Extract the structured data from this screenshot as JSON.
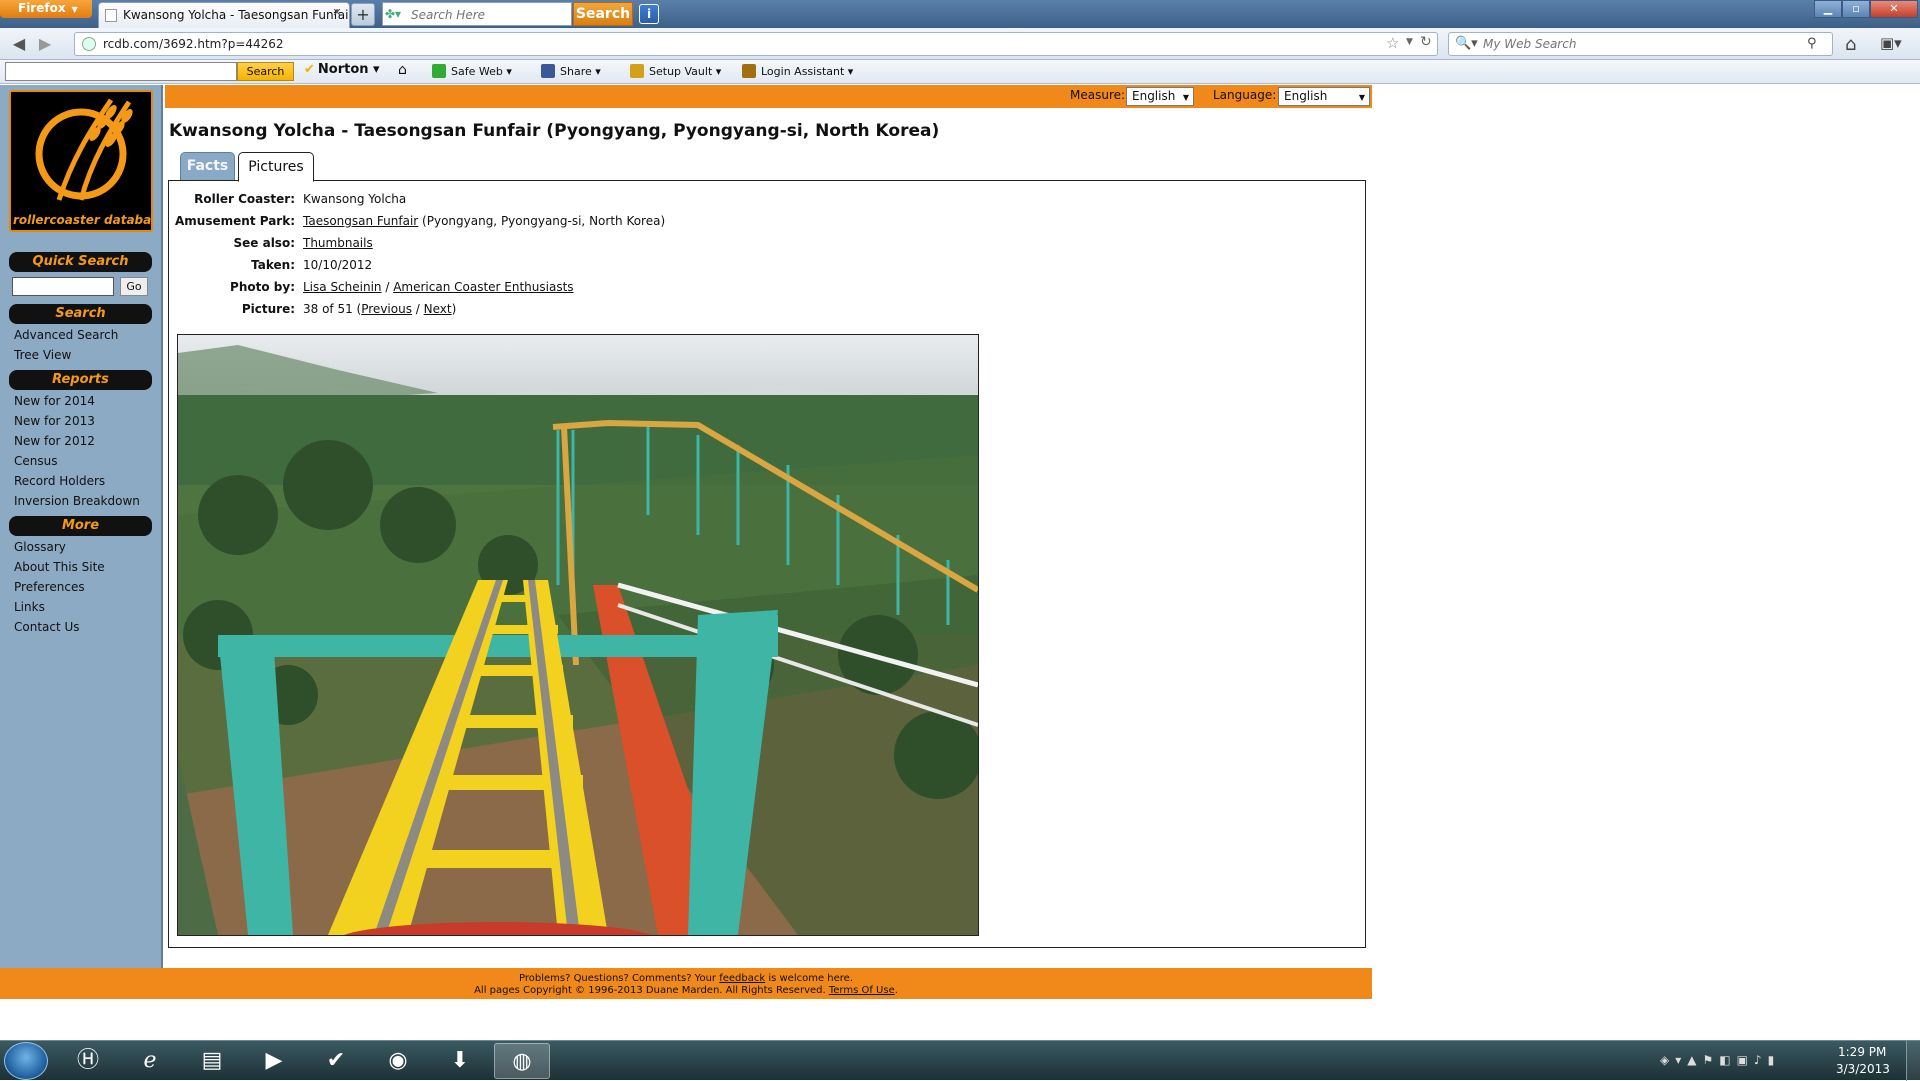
{
  "browser": {
    "firefox_button": "Firefox",
    "tab_title": "Kwansong Yolcha - Taesongsan Funfair ...",
    "new_tab": "+",
    "top_search_placeholder": "Search Here",
    "top_search_button": "Search",
    "url": "rcdb.com/3692.htm?p=44262",
    "web_search_placeholder": "My Web Search"
  },
  "toolbar": {
    "search_button": "Search",
    "norton": "Norton",
    "safe_web": "Safe Web",
    "share": "Share",
    "setup_vault": "Setup Vault",
    "login_assistant": "Login Assistant"
  },
  "header": {
    "measure_label": "Measure:",
    "measure_value": "English",
    "language_label": "Language:",
    "language_value": "English"
  },
  "sidebar": {
    "logo_text": "rollercoaster database",
    "quick_search": "Quick Search",
    "go": "Go",
    "search_head": "Search",
    "search_links": [
      "Advanced Search",
      "Tree View"
    ],
    "reports_head": "Reports",
    "reports_links": [
      "New for 2014",
      "New for 2013",
      "New for 2012",
      "Census",
      "Record Holders",
      "Inversion Breakdown"
    ],
    "more_head": "More",
    "more_links": [
      "Glossary",
      "About This Site",
      "Preferences",
      "Links",
      "Contact Us"
    ]
  },
  "page": {
    "title": "Kwansong Yolcha - Taesongsan Funfair (Pyongyang, Pyongyang-si, North Korea)",
    "tabs": [
      "Facts",
      "Pictures"
    ],
    "facts": {
      "roller_coaster_label": "Roller Coaster:",
      "roller_coaster": "Kwansong Yolcha",
      "park_label": "Amusement Park:",
      "park_link": "Taesongsan Funfair",
      "park_location": " (Pyongyang, Pyongyang-si, North Korea)",
      "see_also_label": "See also:",
      "see_also": "Thumbnails",
      "taken_label": "Taken:",
      "taken": "10/10/2012",
      "photo_by_label": "Photo by:",
      "photographer": "Lisa Scheinin",
      "slash": " / ",
      "club": "American Coaster Enthusiasts",
      "picture_label": "Picture:",
      "picture_count": "38 of 51 (",
      "previous": "Previous",
      "next": "Next",
      "close_paren": ")"
    }
  },
  "footer": {
    "line1_a": "Problems? Questions? Comments? Your ",
    "feedback": "feedback",
    "line1_b": " is welcome here.",
    "line2_a": "All pages Copyright © 1996-2013 Duane Marden. All Rights Reserved. ",
    "terms": "Terms Of Use",
    "line2_b": "."
  },
  "taskbar": {
    "time": "1:29 PM",
    "date": "3/3/2013"
  },
  "colors": {
    "orange": "#f0891a",
    "sidebar_blue": "#8caac4",
    "coaster_track": "#f2d21e",
    "coaster_supports": "#3fb5a6",
    "catwalk": "#d9502a"
  }
}
